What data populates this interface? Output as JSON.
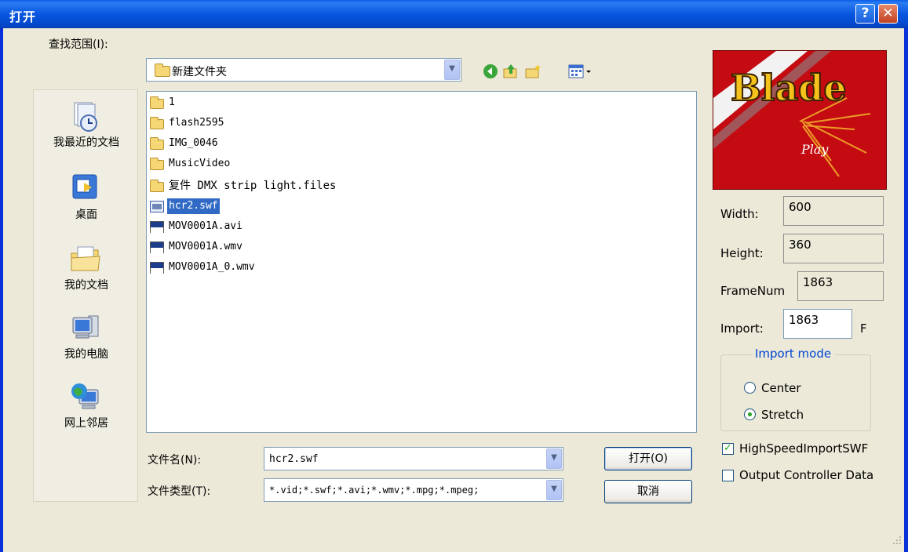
{
  "window": {
    "title": "打开",
    "help_label": "?",
    "close_label": "✕"
  },
  "lookin": {
    "label": "查找范围(I):",
    "value": "新建文件夹"
  },
  "toolbar": {
    "icons": [
      "back-icon",
      "up-folder-icon",
      "new-folder-icon",
      "view-menu-icon"
    ]
  },
  "places": [
    {
      "label": "我最近的文档",
      "icon": "recent-documents-icon"
    },
    {
      "label": "桌面",
      "icon": "desktop-icon"
    },
    {
      "label": "我的文档",
      "icon": "my-documents-icon"
    },
    {
      "label": "我的电脑",
      "icon": "my-computer-icon"
    },
    {
      "label": "网上邻居",
      "icon": "network-places-icon"
    }
  ],
  "files": [
    {
      "name": "1",
      "type": "folder"
    },
    {
      "name": "flash2595",
      "type": "folder"
    },
    {
      "name": "IMG_0046",
      "type": "folder"
    },
    {
      "name": "MusicVideo",
      "type": "folder"
    },
    {
      "name": "复件 DMX strip light.files",
      "type": "folder"
    },
    {
      "name": "hcr2.swf",
      "type": "swf",
      "selected": true
    },
    {
      "name": "MOV0001A.avi",
      "type": "avi"
    },
    {
      "name": "MOV0001A.wmv",
      "type": "wmv"
    },
    {
      "name": "MOV0001A_0.wmv",
      "type": "wmv"
    }
  ],
  "filename": {
    "label": "文件名(N):",
    "value": "hcr2.swf"
  },
  "filetype": {
    "label": "文件类型(T):",
    "value": "*.vid;*.swf;*.avi;*.wmv;*.mpg;*.mpeg;"
  },
  "buttons": {
    "open": "打开(O)",
    "cancel": "取消"
  },
  "preview": {
    "title": "Blade",
    "subtitle": "Play"
  },
  "props": {
    "width_label": "Width:",
    "width_value": "600",
    "height_label": "Height:",
    "height_value": "360",
    "framenum_label": "FrameNum",
    "framenum_value": "1863",
    "import_label": "Import:",
    "import_value": "1863",
    "import_unit": "F"
  },
  "import_mode": {
    "title": "Import mode",
    "options": [
      {
        "label": "Center",
        "checked": false
      },
      {
        "label": "Stretch",
        "checked": true
      }
    ]
  },
  "checks": [
    {
      "label": "HighSpeedImportSWF",
      "checked": true
    },
    {
      "label": "Output Controller Data",
      "checked": false
    }
  ],
  "colors": {
    "title_bar": "#0a5fe8",
    "selection": "#316ac5",
    "preview_bg": "#c40b12"
  }
}
